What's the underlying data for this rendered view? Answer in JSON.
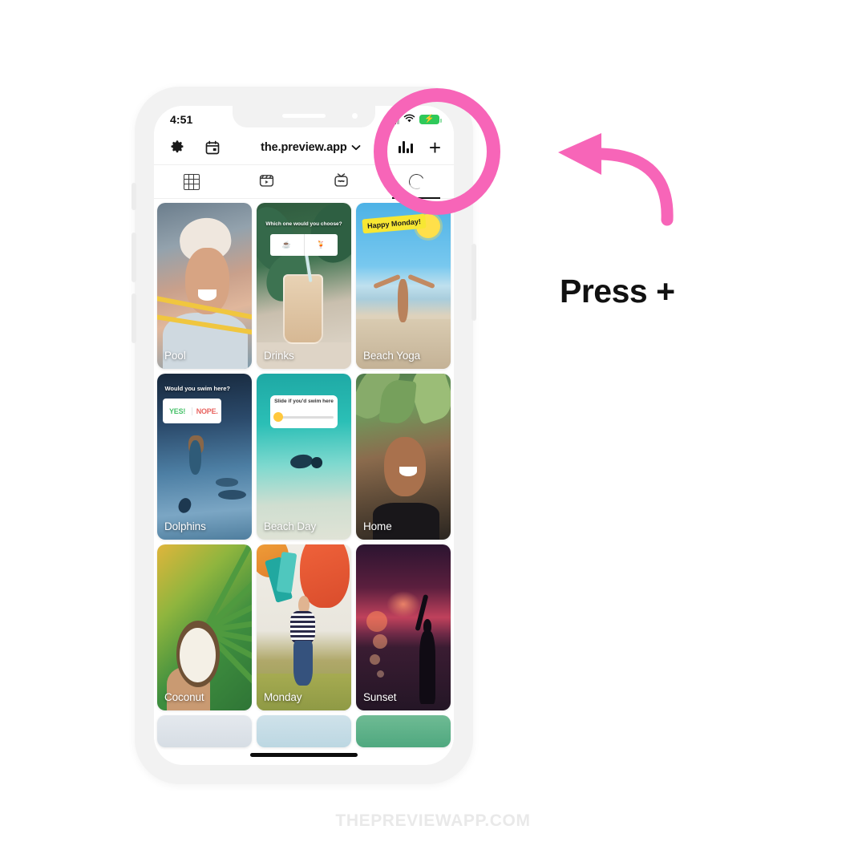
{
  "annotation": {
    "instruction": "Press +",
    "arrow_icon": "curved-arrow-left-icon",
    "highlight_icon": "circle-highlight",
    "accent_color": "#f765b8"
  },
  "watermark": {
    "text": "THEPREVIEWAPP.COM"
  },
  "phone": {
    "status_bar": {
      "time": "4:51",
      "signal_icon": "cellular-signal-icon",
      "wifi_icon": "wifi-icon",
      "battery_icon": "battery-charging-icon",
      "battery_bolt": "⚡"
    },
    "header": {
      "settings_icon": "gear-icon",
      "calendar_icon": "calendar-icon",
      "account_name": "the.preview.app",
      "chevron_icon": "chevron-down-icon",
      "analytics_icon": "bar-chart-icon",
      "add_icon": "plus-icon",
      "add_label": "+"
    },
    "tabs": [
      {
        "name": "grid",
        "icon": "grid-icon",
        "active": false
      },
      {
        "name": "reels",
        "icon": "reels-icon",
        "active": false
      },
      {
        "name": "igtv",
        "icon": "igtv-icon",
        "active": false
      },
      {
        "name": "loading",
        "icon": "spinner-icon",
        "active": true
      }
    ],
    "grid_posts": [
      {
        "label": "Pool",
        "art": "pool"
      },
      {
        "label": "Drinks",
        "art": "drinks",
        "sticker": "Which one would you choose?"
      },
      {
        "label": "Beach Yoga",
        "art": "yoga",
        "sticker": "Happy Monday!"
      },
      {
        "label": "Dolphins",
        "art": "dolphins",
        "sticker": "Would you swim here?",
        "poll_yes": "YES!",
        "poll_no": "NOPE."
      },
      {
        "label": "Beach Day",
        "art": "beachday",
        "sticker": "Slide if you'd swim here"
      },
      {
        "label": "Home",
        "art": "home"
      },
      {
        "label": "Coconut",
        "art": "coconut"
      },
      {
        "label": "Monday",
        "art": "monday"
      },
      {
        "label": "Sunset",
        "art": "sunset"
      }
    ],
    "partial_posts": [
      {
        "art": "p1"
      },
      {
        "art": "p2"
      },
      {
        "art": "p3"
      }
    ],
    "home_indicator": "home-indicator"
  }
}
